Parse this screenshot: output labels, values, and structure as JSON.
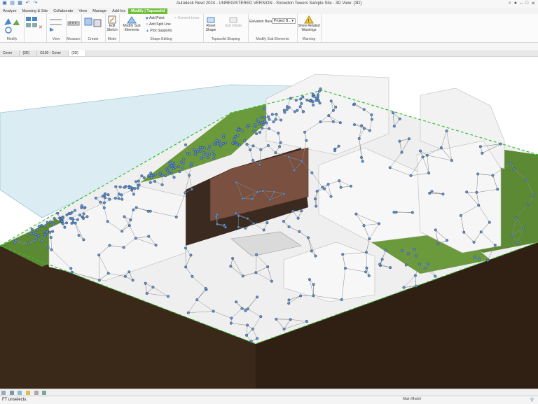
{
  "app_title": "Autodesk Revit 2024 - UNREGISTERED VERSION - Snowdon Towers Sample Site - 3D View: {3D}",
  "tabs": [
    "Analyze",
    "Massing & Site",
    "Collaborate",
    "View",
    "Manage",
    "Add-Ins",
    "Modify | Toposolid"
  ],
  "ribbon": {
    "modify_label": "Modify",
    "view_label": "View",
    "measure_label": "Measure",
    "create_label": "Create",
    "mode": {
      "edit_sketch": "Edit Sketch",
      "label": "Mode"
    },
    "shape_editing": {
      "modify_sub_elements": "Modify Sub Elements",
      "add_point": "Add Point",
      "add_split_line": "Add Split Line",
      "pick_supports": "Pick Supports",
      "convert_lines": "Convert Lines",
      "label": "Shape Editing"
    },
    "toposolid_shaping": {
      "reset_shape": "Reset Shape",
      "sub_divide": "Sub Divide",
      "label": "Toposolid Shaping"
    },
    "modify_sub_elements": {
      "elevation_base_label": "Elevation Base:",
      "elevation_base_value": "Project B...",
      "label": "Modify Sub Elements"
    },
    "warning": {
      "show_related": "Show Related Warnings",
      "label": "Warning"
    }
  },
  "view_tabs": [
    "Cover",
    "{3D}",
    "G100 - Cover",
    "{3D}"
  ],
  "status": {
    "text": "FT unselects.",
    "model": "Main Model"
  },
  "colors": {
    "accent_tab": "#6fbf3a",
    "terrain": "#5c8a34",
    "soil": "#3a2818",
    "points": "#5b8fd0",
    "boundary": "#2fbf2f"
  }
}
